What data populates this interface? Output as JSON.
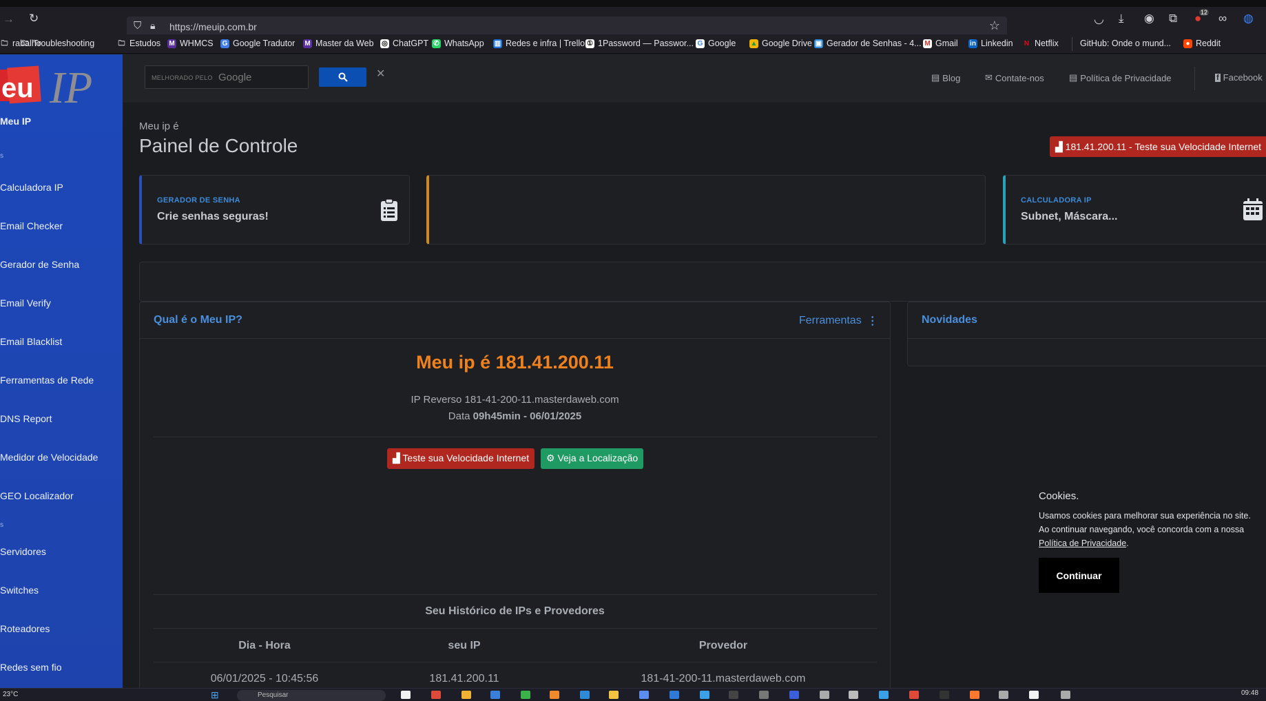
{
  "browser": {
    "url_host": "https://meuip.com.br",
    "bookmarks": [
      {
        "label": "rabalho",
        "icon": "folder-icon"
      },
      {
        "label": "Troubleshooting",
        "icon": "folder-icon"
      },
      {
        "label": "Estudos",
        "icon": "folder-icon"
      },
      {
        "label": "WHMCS",
        "icon": "m-icon"
      },
      {
        "label": "Google Tradutor",
        "icon": "translate-icon"
      },
      {
        "label": "Master da Web",
        "icon": "m-icon"
      },
      {
        "label": "ChatGPT",
        "icon": "chatgpt-icon"
      },
      {
        "label": "WhatsApp",
        "icon": "whatsapp-icon"
      },
      {
        "label": "Redes e infra | Trello",
        "icon": "trello-icon"
      },
      {
        "label": "1Password — Passwor...",
        "icon": "1password-icon"
      },
      {
        "label": "Google",
        "icon": "google-icon"
      },
      {
        "label": "Google Drive",
        "icon": "drive-icon"
      },
      {
        "label": "Gerador de Senhas - 4...",
        "icon": "generator-icon"
      },
      {
        "label": "Gmail",
        "icon": "gmail-icon"
      },
      {
        "label": "Linkedin",
        "icon": "linkedin-icon"
      },
      {
        "label": "Netflix",
        "icon": "netflix-icon"
      },
      {
        "label": "GitHub: Onde o mund...",
        "icon": "github-icon"
      },
      {
        "label": "Reddit",
        "icon": "reddit-icon"
      }
    ],
    "extension_badge": "12"
  },
  "sidebar": {
    "logo_text_a": "eu",
    "logo_text_b": "IP",
    "brand": "Meu IP",
    "section_a": "s",
    "items_a": [
      "Calculadora IP",
      "Email Checker",
      "Gerador de Senha",
      "Email Verify",
      "Email Blacklist",
      "Ferramentas de Rede",
      "DNS Report",
      "Medidor de Velocidade",
      "GEO Localizador"
    ],
    "section_b": "s",
    "items_b": [
      "Servidores",
      "Switches",
      "Roteadores",
      "Redes sem fio"
    ]
  },
  "topbar": {
    "search_small": "MELHORADO PELO",
    "search_google": "Google",
    "nav": [
      "Blog",
      "Contate-nos",
      "Política de Privacidade",
      "Facebook"
    ]
  },
  "header": {
    "subtitle": "Meu ip é",
    "title": "Painel de Controle",
    "speed_btn": "181.41.200.11 - Teste sua Velocidade Internet"
  },
  "kpis": [
    {
      "label": "GERADOR DE SENHA",
      "value": "Crie senhas seguras!",
      "accent": "#2a4fb8"
    },
    {
      "label": "",
      "value": "",
      "accent": "#d08a1c"
    },
    {
      "label": "CALCULADORA IP",
      "value": "Subnet, Máscara...",
      "accent": "#2aa1b8"
    }
  ],
  "ip_panel": {
    "title": "Qual é o Meu IP?",
    "tools": "Ferramentas",
    "headline": "Meu ip é 181.41.200.11",
    "reverse_label": "IP Reverso",
    "reverse_value": "181-41-200-11.masterdaweb.com",
    "date_label": "Data",
    "date_value": "09h45min - 06/01/2025",
    "btn_speed": "Teste sua Velocidade Internet",
    "btn_location": "Veja a Localização",
    "history_title": "Seu Histórico de IPs e Provedores",
    "columns": [
      "Dia - Hora",
      "seu IP",
      "Provedor"
    ],
    "rows": [
      [
        "06/01/2025 - 10:45:56",
        "181.41.200.11",
        "181-41-200-11.masterdaweb.com"
      ]
    ]
  },
  "news_panel": {
    "title": "Novidades"
  },
  "cookie": {
    "title": "Cookies.",
    "text": "Usamos cookies para melhorar sua experiência no site. Ao continuar navegando, você concorda com a nossa",
    "link": "Política de Privacidade",
    "period": ".",
    "button": "Continuar"
  },
  "taskbar": {
    "temp": "23°C",
    "search": "Pesquisar",
    "time": "09:48"
  },
  "colors": {
    "sidebar": "#1d48b9",
    "accent_orange": "#f0821e",
    "btn_red": "#b0271f",
    "btn_green": "#1f9a62",
    "link_blue": "#4a8fdb"
  }
}
